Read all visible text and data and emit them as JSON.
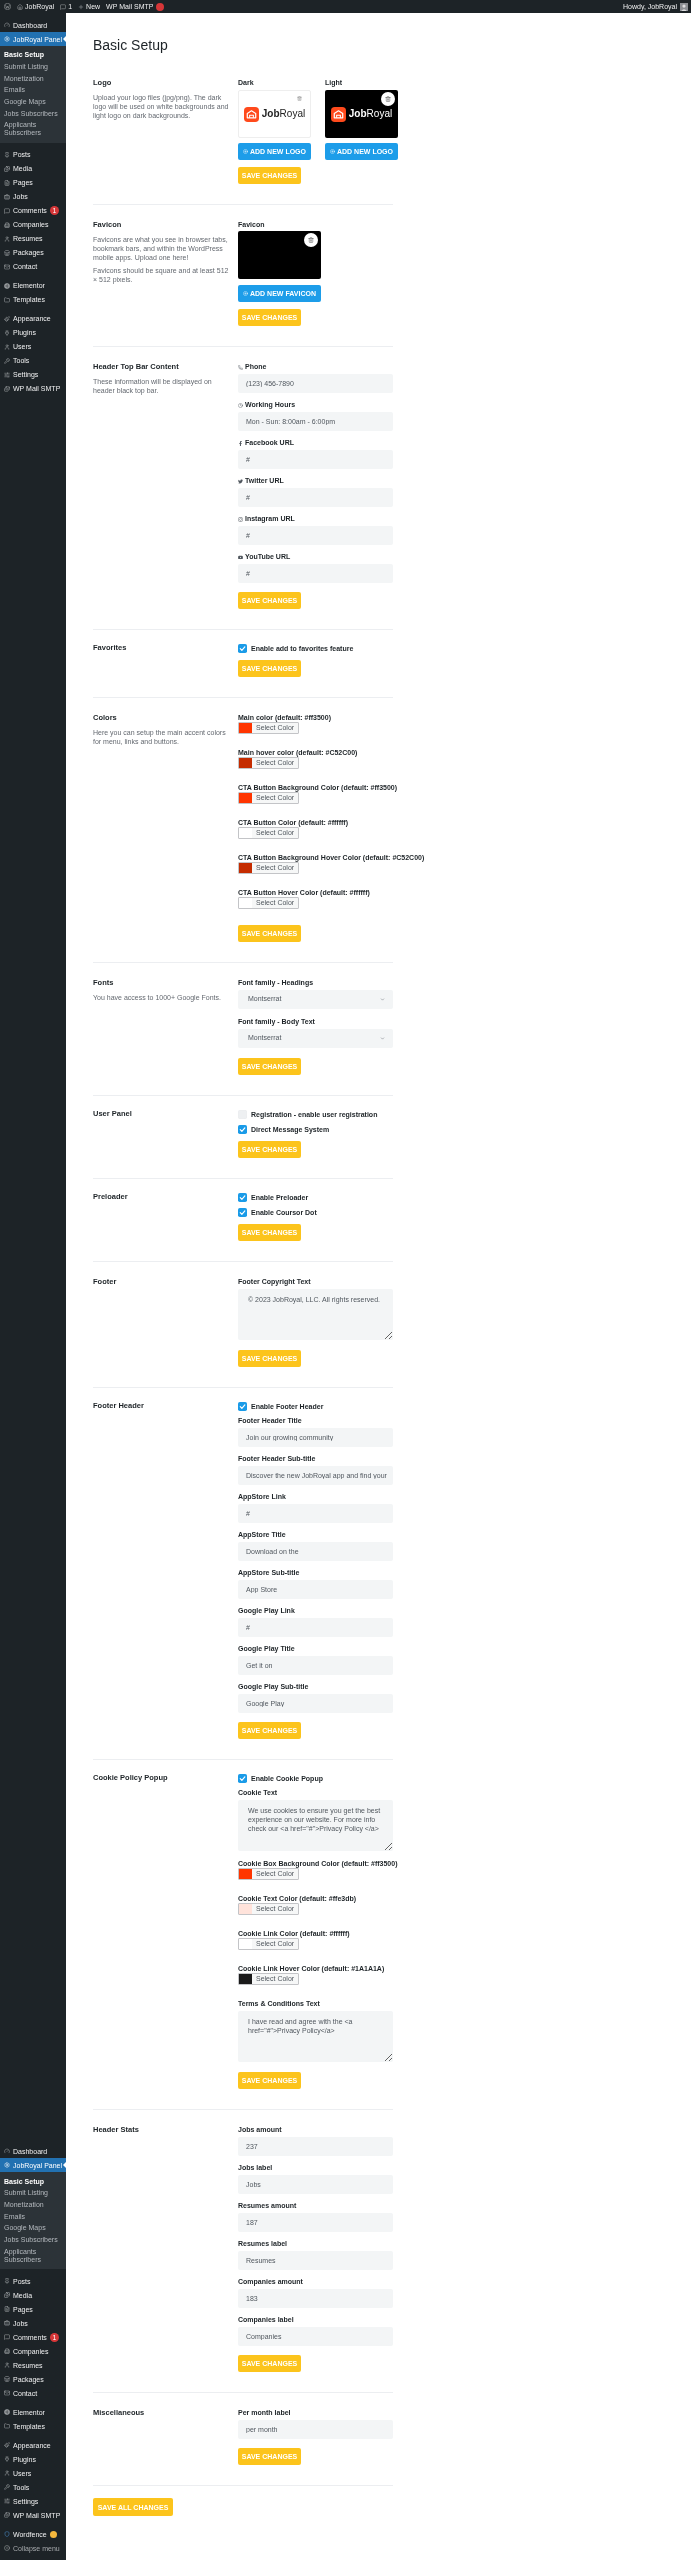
{
  "admin_bar": {
    "site": "JobRoyal",
    "comments": "1",
    "new": "New",
    "plugin": "WP Mail SMTP",
    "plugin_alert": true,
    "greeting": "Howdy, JobRoyal"
  },
  "sidebar_top": {
    "groups": [
      {
        "items": [
          {
            "label": "Dashboard",
            "selected": false
          },
          {
            "label": "JobRoyal Panel",
            "selected": true,
            "children": [
              {
                "label": "Basic Setup",
                "selected": true
              },
              {
                "label": "Submit Listing",
                "selected": false
              },
              {
                "label": "Monetization",
                "selected": false
              },
              {
                "label": "Emails",
                "selected": false
              },
              {
                "label": "Google Maps",
                "selected": false
              },
              {
                "label": "Jobs Subscribers",
                "selected": false
              },
              {
                "label": "Applicants Subscribers",
                "selected": false
              }
            ]
          }
        ]
      },
      {
        "items": [
          {
            "label": "Posts",
            "selected": false
          },
          {
            "label": "Media",
            "selected": false
          },
          {
            "label": "Pages",
            "selected": false
          },
          {
            "label": "Jobs",
            "selected": false
          },
          {
            "label": "Comments",
            "selected": false,
            "badge": "1"
          },
          {
            "label": "Companies",
            "selected": false
          },
          {
            "label": "Resumes",
            "selected": false
          },
          {
            "label": "Packages",
            "selected": false
          },
          {
            "label": "Contact",
            "selected": false
          }
        ]
      },
      {
        "items": [
          {
            "label": "Elementor",
            "selected": false
          },
          {
            "label": "Templates",
            "selected": false
          }
        ]
      },
      {
        "items": [
          {
            "label": "Appearance",
            "selected": false
          },
          {
            "label": "Plugins",
            "selected": false
          },
          {
            "label": "Users",
            "selected": false
          },
          {
            "label": "Tools",
            "selected": false
          },
          {
            "label": "Settings",
            "selected": false
          },
          {
            "label": "WP Mail SMTP",
            "selected": false
          }
        ]
      }
    ]
  },
  "page": {
    "title": "Basic Setup"
  },
  "sections": [
    {
      "title": "Logo",
      "description": [
        "Upload your logo files (jpg/png). The dark logo will be used on white backgrounds and light logo on dark backgrounds."
      ],
      "fields": [
        {
          "kind": "logo_pair",
          "logos": [
            {
              "label": "Dark",
              "logo_text": "**Job**Royal",
              "button": "ADD NEW LOGO"
            },
            {
              "label": "Light",
              "logo_text": "**Job**Royal",
              "button": "ADD NEW LOGO"
            }
          ]
        }
      ],
      "save": "SAVE CHANGES"
    },
    {
      "title": "Favicon",
      "description": [
        "Favicons are what you see in browser tabs, bookmark bars, and within the WordPress mobile apps. Upload one here!",
        "Favicons should be square and at least 512 × 512 pixels."
      ],
      "fields": [
        {
          "kind": "favicon",
          "label": "Favicon",
          "button": "ADD NEW FAVICON"
        }
      ],
      "save": "SAVE CHANGES"
    },
    {
      "title": "Header Top Bar Content",
      "description": [
        "These information will be displayed on header black top bar."
      ],
      "fields": [
        {
          "kind": "icon_text",
          "label": "Phone",
          "value": "(123) 456-7890"
        },
        {
          "kind": "icon_text",
          "label": "Working Hours",
          "value": "Mon - Sun: 8:00am - 6:00pm"
        },
        {
          "kind": "icon_text",
          "label": "Facebook URL",
          "value": "#"
        },
        {
          "kind": "icon_text",
          "label": "Twitter URL",
          "value": "#"
        },
        {
          "kind": "icon_text",
          "label": "Instagram URL",
          "value": "#"
        },
        {
          "kind": "icon_text",
          "label": "YouTube URL",
          "value": "#"
        }
      ],
      "save": "SAVE CHANGES"
    },
    {
      "title": "Favorites",
      "fields": [
        {
          "kind": "checkbox",
          "label": "Enable add to favorites feature",
          "checked": true
        }
      ],
      "save": "SAVE CHANGES"
    },
    {
      "title": "Colors",
      "description": [
        "Here you can setup the main accent colors for menu, links and buttons."
      ],
      "fields": [
        {
          "kind": "color",
          "label": "Main color (default: #ff3500)",
          "color": "#ff3500",
          "button": "Select Color"
        },
        {
          "kind": "color",
          "label": "Main hover color (default: #C52C00)",
          "color": "#c52c00",
          "button": "Select Color"
        },
        {
          "kind": "color",
          "label": "CTA Button Background Color (default: #ff3500)",
          "color": "#ff3500",
          "button": "Select Color"
        },
        {
          "kind": "color",
          "label": "CTA Button Color (default: #ffffff)",
          "color": "#ffffff",
          "button": "Select Color"
        },
        {
          "kind": "color",
          "label": "CTA Button Background Hover Color (default: #C52C00)",
          "color": "#c52c00",
          "button": "Select Color"
        },
        {
          "kind": "color",
          "label": "CTA Button Hover Color (default: #ffffff)",
          "color": "#ffffff",
          "button": "Select Color"
        }
      ],
      "save": "SAVE CHANGES"
    },
    {
      "title": "Fonts",
      "description": [
        "You have access to 1000+ Google Fonts."
      ],
      "fields": [
        {
          "kind": "select",
          "label": "Font family - Headings",
          "value": "Montserrat"
        },
        {
          "kind": "select",
          "label": "Font family - Body Text",
          "value": "Montserrat"
        }
      ],
      "save": "SAVE CHANGES"
    },
    {
      "title": "User Panel",
      "fields": [
        {
          "kind": "checkbox",
          "label": "Registration - enable user registration",
          "checked": false
        },
        {
          "kind": "checkbox",
          "label": "Direct Message System",
          "checked": true
        }
      ],
      "save": "SAVE CHANGES"
    },
    {
      "title": "Preloader",
      "fields": [
        {
          "kind": "checkbox",
          "label": "Enable Preloader",
          "checked": true
        },
        {
          "kind": "checkbox",
          "label": "Enable Coursor Dot",
          "checked": true
        }
      ],
      "save": "SAVE CHANGES"
    },
    {
      "title": "Footer",
      "fields": [
        {
          "kind": "textarea",
          "label": "Footer Copyright Text",
          "value": "© 2023 JobRoyal, LLC. All rights reserved."
        }
      ],
      "save": "SAVE CHANGES"
    },
    {
      "title": "Footer Header",
      "fields": [
        {
          "kind": "checkbox",
          "label": "Enable Footer Header",
          "checked": true
        },
        {
          "kind": "text",
          "label": "Footer Header Title",
          "value": "Join our growing community"
        },
        {
          "kind": "text",
          "label": "Footer Header Sub-title",
          "value": "Discover the new JobRoyal app and find your"
        },
        {
          "kind": "text",
          "label": "AppStore Link",
          "value": "#"
        },
        {
          "kind": "text",
          "label": "AppStore Title",
          "value": "Download on the"
        },
        {
          "kind": "text",
          "label": "AppStore Sub-title",
          "value": "App Store"
        },
        {
          "kind": "text",
          "label": "Google Play Link",
          "value": "#"
        },
        {
          "kind": "text",
          "label": "Google Play Title",
          "value": "Get it on"
        },
        {
          "kind": "text",
          "label": "Google Play Sub-title",
          "value": "Google Play"
        }
      ],
      "save": "SAVE CHANGES"
    },
    {
      "title": "Cookie Policy Popup",
      "fields": [
        {
          "kind": "checkbox",
          "label": "Enable Cookie Popup",
          "checked": true
        },
        {
          "kind": "textarea",
          "label": "Cookie Text",
          "value": "We use cookies to ensure you get the best experience on our website. For more info check our <a href=\"#\">Privacy Policy </a>"
        },
        {
          "kind": "color",
          "label": "Cookie Box Background Color (default: #ff3500)",
          "color": "#ff3500",
          "button": "Select Color"
        },
        {
          "kind": "color",
          "label": "Cookie Text Color (default: #ffe3db)",
          "color": "#ffe3db",
          "button": "Select Color"
        },
        {
          "kind": "color",
          "label": "Cookie Link Color (default: #ffffff)",
          "color": "#ffffff",
          "button": "Select Color"
        },
        {
          "kind": "color",
          "label": "Cookie Link Hover Color (default: #1A1A1A)",
          "color": "#1a1a1a",
          "button": "Select Color"
        },
        {
          "kind": "textarea",
          "label": "Terms & Conditions Text",
          "value": "I have read and agree with the <a href=\"#\">Privacy Policy</a>"
        }
      ],
      "save": "SAVE CHANGES"
    },
    {
      "title": "Header Stats",
      "fields": [
        {
          "kind": "text",
          "label": "Jobs amount",
          "value": "237"
        },
        {
          "kind": "text",
          "label": "Jobs label",
          "value": "Jobs"
        },
        {
          "kind": "text",
          "label": "Resumes amount",
          "value": "187"
        },
        {
          "kind": "text",
          "label": "Resumes label",
          "value": "Resumes"
        },
        {
          "kind": "text",
          "label": "Companies amount",
          "value": "183"
        },
        {
          "kind": "text",
          "label": "Companies label",
          "value": "Companies"
        }
      ],
      "save": "SAVE CHANGES"
    },
    {
      "title": "Miscellaneous",
      "fields": [
        {
          "kind": "text",
          "label": "Per month label",
          "value": "per month"
        }
      ],
      "save": "SAVE CHANGES"
    }
  ],
  "save_all": "SAVE ALL CHANGES",
  "sidebar_bottom": {
    "groups": [
      {
        "items": [
          {
            "label": "Dashboard",
            "selected": false
          },
          {
            "label": "JobRoyal Panel",
            "selected": true,
            "children": [
              {
                "label": "Basic Setup",
                "selected": true
              },
              {
                "label": "Submit Listing",
                "selected": false
              },
              {
                "label": "Monetization",
                "selected": false
              },
              {
                "label": "Emails",
                "selected": false
              },
              {
                "label": "Google Maps",
                "selected": false
              },
              {
                "label": "Jobs Subscribers",
                "selected": false
              },
              {
                "label": "Applicants Subscribers",
                "selected": false
              }
            ]
          }
        ]
      },
      {
        "items": [
          {
            "label": "Posts",
            "selected": false
          },
          {
            "label": "Media",
            "selected": false
          },
          {
            "label": "Pages",
            "selected": false
          },
          {
            "label": "Jobs",
            "selected": false
          },
          {
            "label": "Comments",
            "selected": false,
            "badge": "1"
          },
          {
            "label": "Companies",
            "selected": false
          },
          {
            "label": "Resumes",
            "selected": false
          },
          {
            "label": "Packages",
            "selected": false
          },
          {
            "label": "Contact",
            "selected": false
          }
        ]
      },
      {
        "items": [
          {
            "label": "Elementor",
            "selected": false
          },
          {
            "label": "Templates",
            "selected": false
          }
        ]
      },
      {
        "items": [
          {
            "label": "Appearance",
            "selected": false
          },
          {
            "label": "Plugins",
            "selected": false
          },
          {
            "label": "Users",
            "selected": false
          },
          {
            "label": "Tools",
            "selected": false
          },
          {
            "label": "Settings",
            "selected": false
          },
          {
            "label": "WP Mail SMTP",
            "selected": false
          }
        ]
      },
      {
        "items": [
          {
            "label": "Wordfence",
            "selected": false,
            "color": "#f5b83d"
          }
        ]
      }
    ],
    "collapse": "Collapse menu"
  }
}
